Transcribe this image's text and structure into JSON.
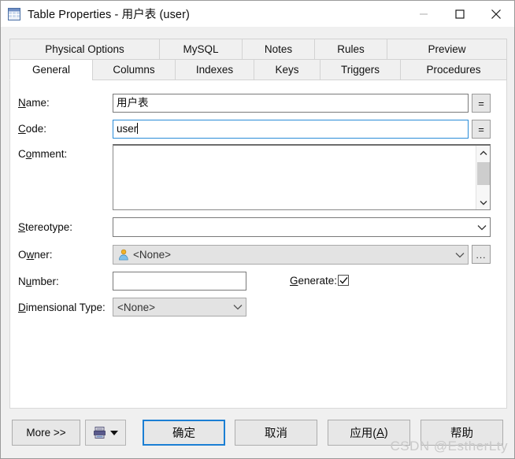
{
  "window": {
    "title": "Table Properties - 用户表 (user)",
    "icon": "table-icon",
    "minimize_label": "—",
    "maximize_label": "▢",
    "close_label": "✕"
  },
  "tabs": {
    "row1": [
      {
        "label": "Physical Options",
        "selected": false,
        "width": 190
      },
      {
        "label": "MySQL",
        "selected": false,
        "width": 105
      },
      {
        "label": "Notes",
        "selected": false,
        "width": 92
      },
      {
        "label": "Rules",
        "selected": false,
        "width": 92
      },
      {
        "label": "Preview",
        "selected": false,
        "width": 153
      }
    ],
    "row2": [
      {
        "label": "General",
        "selected": true,
        "width": 105
      },
      {
        "label": "Columns",
        "selected": false,
        "width": 105
      },
      {
        "label": "Indexes",
        "selected": false,
        "width": 100
      },
      {
        "label": "Keys",
        "selected": false,
        "width": 84
      },
      {
        "label": "Triggers",
        "selected": false,
        "width": 102
      },
      {
        "label": "Procedures",
        "selected": false,
        "width": 136
      }
    ]
  },
  "form": {
    "name": {
      "label_pre": "",
      "label_key": "N",
      "label_post": "ame:",
      "value": "用户表",
      "equals_label": "=",
      "focused": false
    },
    "code": {
      "label_pre": "",
      "label_key": "C",
      "label_post": "ode:",
      "value": "user",
      "equals_label": "=",
      "focused": true
    },
    "comment": {
      "label_pre": "C",
      "label_key": "o",
      "label_post": "mment:",
      "value": ""
    },
    "stereotype": {
      "label_pre": "",
      "label_key": "S",
      "label_post": "tereotype:",
      "value": ""
    },
    "owner": {
      "label_pre": "O",
      "label_key": "w",
      "label_post": "ner:",
      "value": "<None>",
      "icon": "person-icon",
      "browse_label": "...",
      "disabled": true
    },
    "number": {
      "label_pre": "N",
      "label_key": "u",
      "label_post": "mber:",
      "value": ""
    },
    "generate": {
      "label_pre": "",
      "label_key": "G",
      "label_post": "enerate:",
      "checked": true
    },
    "dimensional_type": {
      "label_pre": "",
      "label_key": "D",
      "label_post": "imensional Type:",
      "value": "<None>",
      "disabled": true
    }
  },
  "footer": {
    "more_label": "More >>",
    "print_icon": "print-icon",
    "print_dropdown_icon": "caret-down-icon",
    "ok_label": "确定",
    "cancel_label": "取消",
    "apply_pre": "应用(",
    "apply_key": "A",
    "apply_post": ")",
    "help_label": "帮助"
  },
  "watermark": {
    "text": "CSDN @EstherLty"
  }
}
